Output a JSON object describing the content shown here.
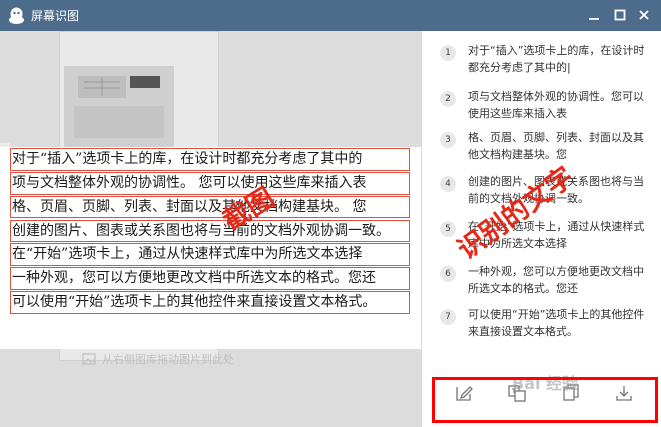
{
  "window": {
    "title": "屏幕识图",
    "controls": [
      "minimize-icon",
      "maximize-icon",
      "close-icon"
    ]
  },
  "preview": {
    "hint": "从右侧图库拖动图片到此处",
    "ocr_lines": [
      "对于“插入”选项卡上的库，在设计时都充分考虑了其中的",
      "项与文档整体外观的协调性。 您可以使用这些库来插入表",
      "格、页眉、页脚、列表、封面以及其他文档构建基块。 您",
      "创建的图片、图表或关系图也将与当前的文档外观协调一致。",
      "在“开始”选项卡上，通过从快速样式库中为所选文本选择",
      "一种外观，您可以方便地更改文档中所选文本的格式。您还",
      "可以使用“开始”选项卡上的其他控件来直接设置文本格式。"
    ]
  },
  "results": [
    {
      "num": "1",
      "text": "对于“插入”选项卡上的库，在设计时都充分考虑了其中的|"
    },
    {
      "num": "2",
      "text": "项与文档整体外观的协调性。您可以使用这些库来插入表"
    },
    {
      "num": "3",
      "text": "格、页眉、页脚、列表、封面以及其他文档构建基块。您"
    },
    {
      "num": "4",
      "text": "创建的图片、图表或关系图也将与当前的文档外观协调一致。"
    },
    {
      "num": "5",
      "text": "在“开始”选项卡上，通过从快速样式库中为所选文本选择"
    },
    {
      "num": "6",
      "text": "一种外观，您可以方便地更改文档中所选文本的格式。您还"
    },
    {
      "num": "7",
      "text": "可以使用“开始”选项卡上的其他控件来直接设置文本格式。"
    }
  ],
  "toolbar": {
    "icons": [
      "edit-icon",
      "translate-icon",
      "copy-icon",
      "download-icon"
    ]
  },
  "annotations": {
    "screenshot_label": "截图",
    "recognized_label": "识别的文字"
  },
  "watermark": "Bai 经验",
  "colors": {
    "titlebar": "#4d6c8c",
    "annotation_red": "#e32a1a",
    "ocr_box": "#e0503c"
  }
}
